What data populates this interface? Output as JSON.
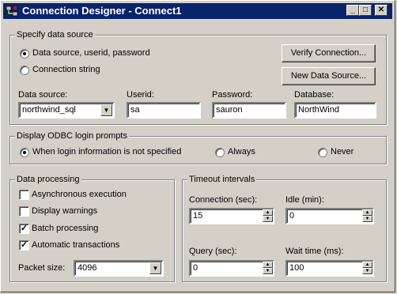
{
  "window": {
    "title": "Connection Designer - Connect1",
    "minimize_label": "_",
    "maximize_label": "□",
    "close_label": "✕"
  },
  "data_source_group": {
    "label": "Specify data source",
    "radio_dsn": "Data source, userid, password",
    "radio_connstr": "Connection string",
    "verify_button": "Verify Connection...",
    "new_ds_button": "New Data Source...",
    "data_source_label": "Data source:",
    "data_source_value": "northwind_sql",
    "userid_label": "Userid:",
    "userid_value": "sa",
    "password_label": "Password:",
    "password_value": "sauron",
    "database_label": "Database:",
    "database_value": "NorthWind",
    "selected": "dsn"
  },
  "odbc_group": {
    "label": "Display ODBC login prompts",
    "when_needed": "When login information is not specified",
    "always": "Always",
    "never": "Never",
    "selected": "when_needed"
  },
  "data_processing": {
    "label": "Data processing",
    "async": "Asynchronous execution",
    "async_checked": false,
    "warnings": "Display warnings",
    "warnings_checked": false,
    "batch": "Batch processing",
    "batch_checked": true,
    "auto_tx": "Automatic transactions",
    "auto_tx_checked": true,
    "packet_label": "Packet size:",
    "packet_value": "4096"
  },
  "timeout": {
    "label": "Timeout intervals",
    "connection_label": "Connection (sec):",
    "connection_value": "15",
    "idle_label": "Idle (min):",
    "idle_value": "0",
    "query_label": "Query (sec):",
    "query_value": "0",
    "wait_label": "Wait time (ms):",
    "wait_value": "100"
  }
}
